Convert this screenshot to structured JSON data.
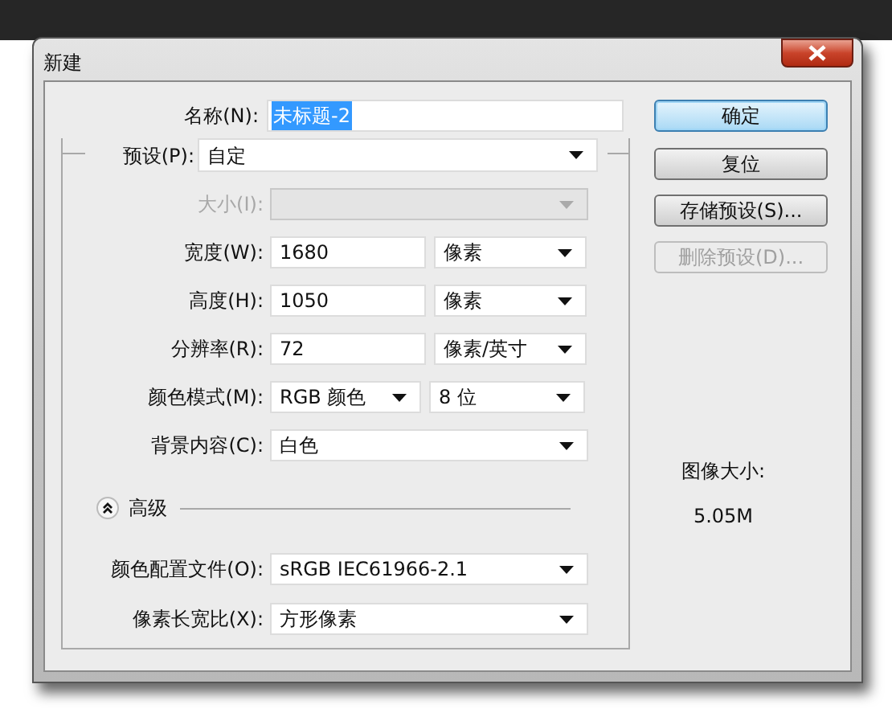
{
  "window": {
    "title": "新建"
  },
  "name_field": {
    "label": "名称(N):",
    "value": "未标题-2",
    "selected": true
  },
  "preset": {
    "label": "预设(P):",
    "value": "自定"
  },
  "rows": [
    {
      "kind": "select",
      "label": "大小(I):",
      "disabled": true
    },
    {
      "kind": "input_unit",
      "label": "宽度(W):",
      "value": "1680",
      "unit": "像素"
    },
    {
      "kind": "input_unit",
      "label": "高度(H):",
      "value": "1050",
      "unit": "像素"
    },
    {
      "kind": "input_unit",
      "label": "分辨率(R):",
      "value": "72",
      "unit": "像素/英寸"
    },
    {
      "kind": "select_pair",
      "label": "颜色模式(M):",
      "value": "RGB 颜色",
      "value2": "8 位"
    },
    {
      "kind": "select",
      "label": "背景内容(C):",
      "value": "白色",
      "disabled": false
    }
  ],
  "advanced": {
    "label": "高级",
    "expanded": true
  },
  "advanced_rows": [
    {
      "kind": "select",
      "label": "颜色配置文件(O):",
      "value": "sRGB IEC61966-2.1",
      "disabled": false
    },
    {
      "kind": "select",
      "label": "像素长宽比(X):",
      "value": "方形像素",
      "disabled": false
    }
  ],
  "buttons": [
    {
      "label": "确定",
      "default": true,
      "disabled": false
    },
    {
      "label": "复位",
      "default": false,
      "disabled": false
    },
    {
      "label": "存储预设(S)...",
      "default": false,
      "disabled": false
    },
    {
      "label": "删除预设(D)...",
      "default": false,
      "disabled": true
    }
  ],
  "image_size": {
    "label": "图像大小:",
    "value": "5.05M"
  }
}
